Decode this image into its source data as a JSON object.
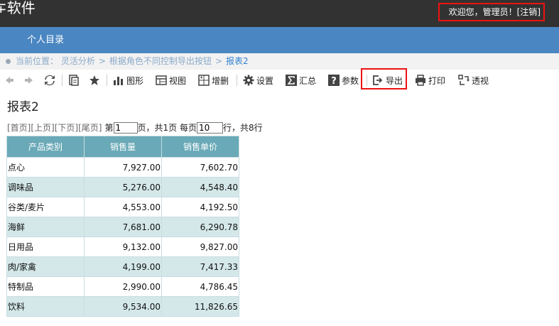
{
  "header": {
    "app_title": "∓软件",
    "welcome": "欢迎您，管理员！[",
    "logout": "注销",
    "bracket_close": "]"
  },
  "nav": {
    "items": [
      {
        "label": "个人目录"
      }
    ]
  },
  "breadcrumb": {
    "prefix": "当前位置：",
    "items": [
      "灵活分析",
      "根据角色不同控制导出按钮",
      "报表2"
    ],
    "sep": ">"
  },
  "toolbar": {
    "chart": "图形",
    "view": "视图",
    "addremove": "增删",
    "settings": "设置",
    "summary": "汇总",
    "params": "参数",
    "export": "导出",
    "print": "打印",
    "pivot": "透视"
  },
  "report": {
    "title": "报表2",
    "pager": {
      "first": "[首页]",
      "prev": "[上页]",
      "next": "[下页]",
      "last": "[尾页]",
      "page_label": "第",
      "page_value": "1",
      "page_suffix": "页，共1页 每页",
      "rows_value": "10",
      "rows_suffix": "行，共8行"
    },
    "columns": [
      "产品类别",
      "销售量",
      "销售单价"
    ],
    "rows": [
      [
        "点心",
        "7,927.00",
        "7,602.70"
      ],
      [
        "调味品",
        "5,276.00",
        "4,548.40"
      ],
      [
        "谷类/麦片",
        "4,553.00",
        "4,192.50"
      ],
      [
        "海鲜",
        "7,681.00",
        "6,290.78"
      ],
      [
        "日用品",
        "9,132.00",
        "9,827.00"
      ],
      [
        "肉/家禽",
        "4,199.00",
        "7,417.33"
      ],
      [
        "特制品",
        "2,990.00",
        "4,786.45"
      ],
      [
        "饮料",
        "9,534.00",
        "11,826.65"
      ]
    ]
  },
  "colors": {
    "accent": "#4a86c1",
    "header_bg": "#323232",
    "highlight": "#ee1111",
    "table_head": "#6aa9b7",
    "table_alt": "#d4e8ea"
  }
}
